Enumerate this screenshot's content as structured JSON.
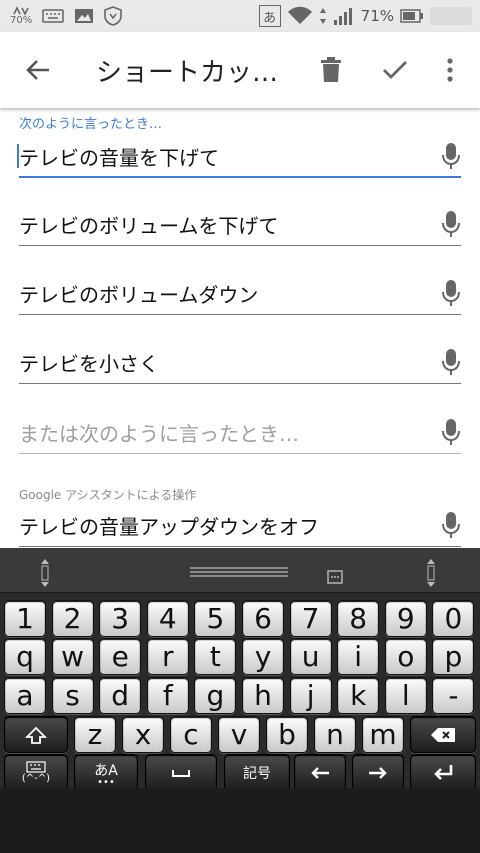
{
  "status_bar": {
    "signal_label": "70%",
    "ime_indicator": "あ",
    "battery_percent": "71%"
  },
  "app_bar": {
    "title": "ショートカッ…"
  },
  "content": {
    "section1_label": "次のように言ったとき…",
    "phrases": [
      "テレビの音量を下げて",
      "テレビのボリュームを下げて",
      "テレビのボリュームダウン",
      "テレビを小さく"
    ],
    "new_phrase_placeholder": "または次のように言ったとき…",
    "section2_label": "Google アシスタントによる操作",
    "action": "テレビの音量アップダウンをオフ"
  },
  "keyboard": {
    "row1": [
      "1",
      "2",
      "3",
      "4",
      "5",
      "6",
      "7",
      "8",
      "9",
      "0"
    ],
    "row2": [
      "q",
      "w",
      "e",
      "r",
      "t",
      "y",
      "u",
      "i",
      "o",
      "p"
    ],
    "row3": [
      "a",
      "s",
      "d",
      "f",
      "g",
      "h",
      "j",
      "k",
      "l",
      "-"
    ],
    "row4": [
      "z",
      "x",
      "c",
      "v",
      "b",
      "n",
      "m"
    ],
    "kana_label": "あA",
    "symbol_label": "記号",
    "emoji_label": "(^-^)"
  },
  "colors": {
    "accent": "#3d7bd9",
    "label_gray": "#8a8a8a"
  }
}
